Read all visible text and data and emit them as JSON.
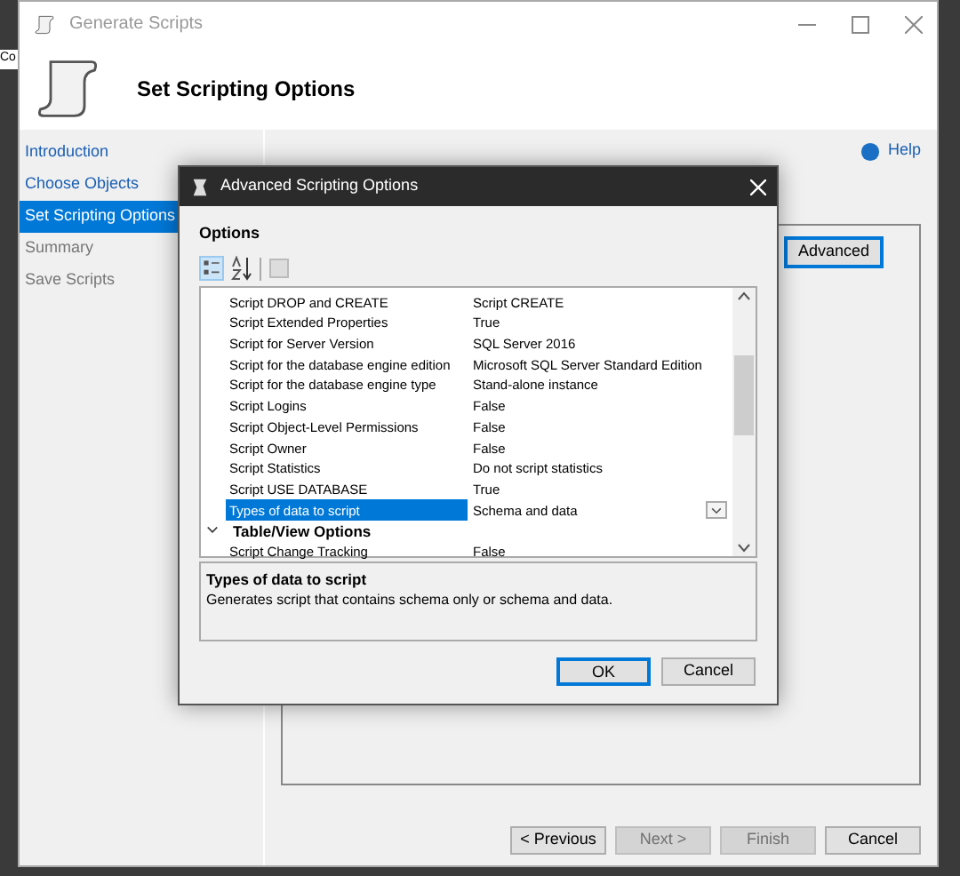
{
  "background_text": "Co",
  "window": {
    "title": "Generate Scripts",
    "heading": "Set Scripting Options"
  },
  "nav": [
    {
      "label": "Introduction",
      "selected": false,
      "disabled": false
    },
    {
      "label": "Choose Objects",
      "selected": false,
      "disabled": false
    },
    {
      "label": "Set Scripting Options",
      "selected": true,
      "disabled": false
    },
    {
      "label": "Summary",
      "selected": false,
      "disabled": true
    },
    {
      "label": "Save Scripts",
      "selected": false,
      "disabled": true
    }
  ],
  "help": "Help",
  "advanced_button": "Advanced",
  "dialog": {
    "title": "Advanced Scripting Options",
    "options_label": "Options",
    "rows": [
      {
        "kind": "property",
        "name": "Script DROP and CREATE",
        "value": "Script CREATE",
        "selected": false
      },
      {
        "kind": "property",
        "name": "Script Extended Properties",
        "value": "True",
        "selected": false
      },
      {
        "kind": "property",
        "name": "Script for Server Version",
        "value": "SQL Server 2016",
        "selected": false
      },
      {
        "kind": "property",
        "name": "Script for the database engine edition",
        "value": "Microsoft SQL Server Standard Edition",
        "selected": false
      },
      {
        "kind": "property",
        "name": "Script for the database engine type",
        "value": "Stand-alone instance",
        "selected": false
      },
      {
        "kind": "property",
        "name": "Script Logins",
        "value": "False",
        "selected": false
      },
      {
        "kind": "property",
        "name": "Script Object-Level Permissions",
        "value": "False",
        "selected": false
      },
      {
        "kind": "property",
        "name": "Script Owner",
        "value": "False",
        "selected": false
      },
      {
        "kind": "property",
        "name": "Script Statistics",
        "value": "Do not script statistics",
        "selected": false
      },
      {
        "kind": "property",
        "name": "Script USE DATABASE",
        "value": "True",
        "selected": false
      },
      {
        "kind": "property",
        "name": "Types of data to script",
        "value": "Schema and data",
        "selected": true
      },
      {
        "kind": "category",
        "name": "Table/View Options",
        "expanded": true
      },
      {
        "kind": "property",
        "name": "Script Change Tracking",
        "value": "False",
        "selected": false
      }
    ],
    "description_title": "Types of data to script",
    "description": "Generates script that contains schema only or schema and data.",
    "buttons": [
      {
        "label": "OK",
        "default": true
      },
      {
        "label": "Cancel",
        "default": false
      }
    ]
  },
  "footer_buttons": [
    {
      "label": "< Previous",
      "disabled": false
    },
    {
      "label": "Next >",
      "disabled": true
    },
    {
      "label": "Finish",
      "disabled": true
    },
    {
      "label": "Cancel",
      "disabled": false
    }
  ]
}
